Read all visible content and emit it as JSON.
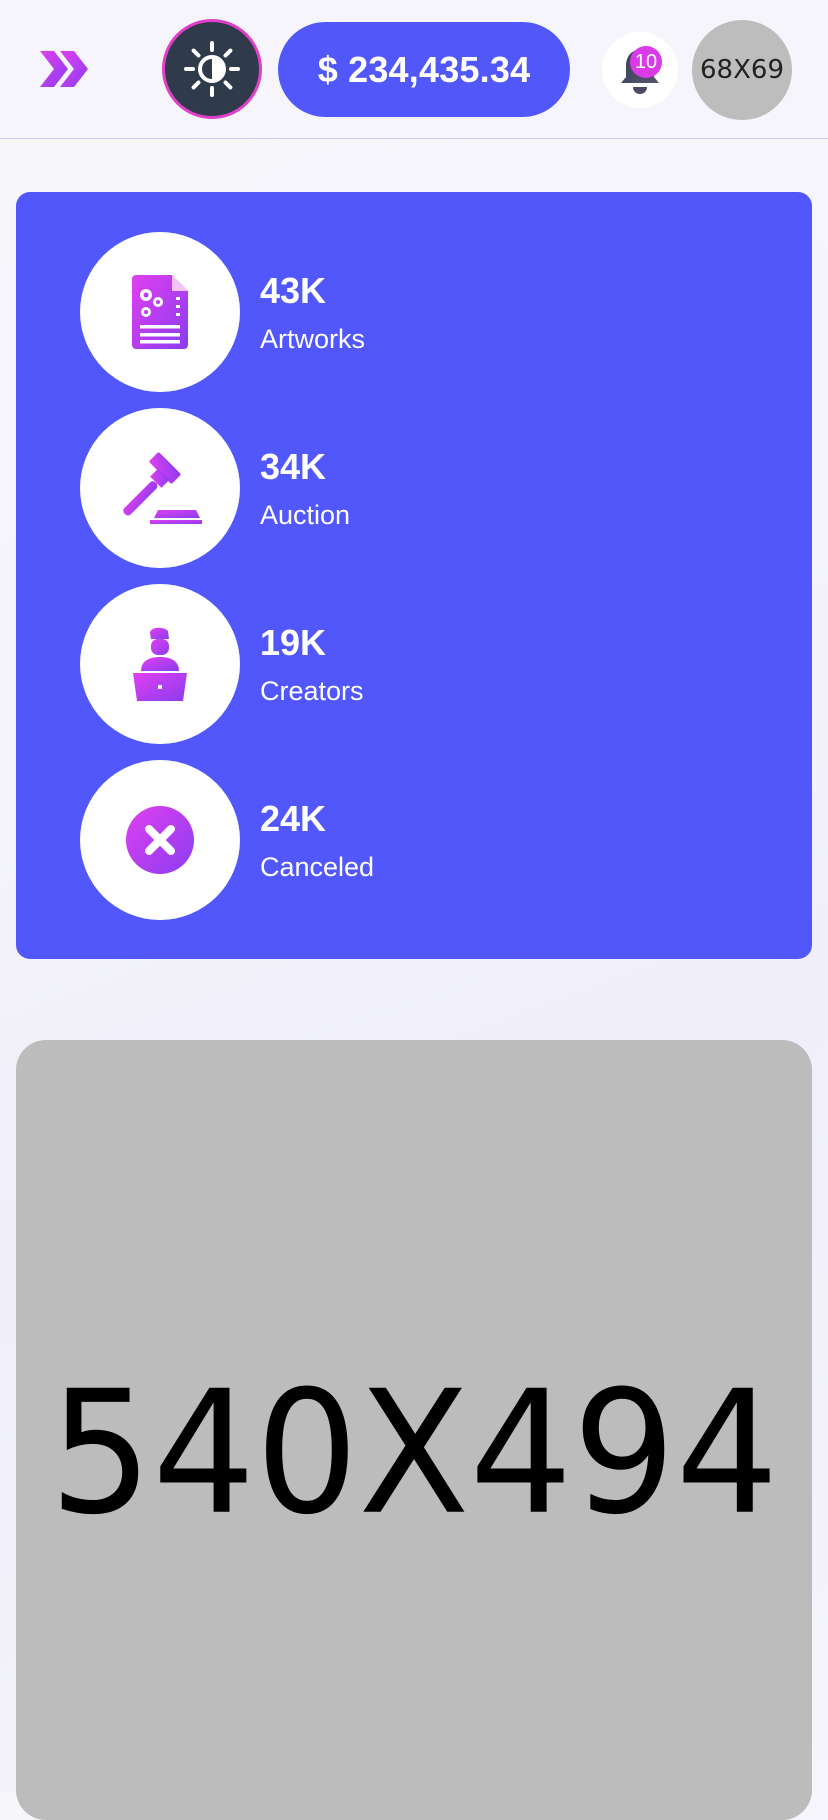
{
  "header": {
    "balance": "$ 234,435.34",
    "notification_count": "10",
    "avatar_label": "68X69"
  },
  "stats": [
    {
      "value": "43K",
      "label": "Artworks",
      "icon": "document-gear-icon"
    },
    {
      "value": "34K",
      "label": "Auction",
      "icon": "gavel-icon"
    },
    {
      "value": "19K",
      "label": "Creators",
      "icon": "creator-icon"
    },
    {
      "value": "24K",
      "label": "Canceled",
      "icon": "cancel-icon"
    }
  ],
  "image_placeholder": {
    "label": "540X494"
  },
  "colors": {
    "accent": "#5157fa",
    "icon_gradient_start": "#e040f0",
    "icon_gradient_end": "#8a3cf0",
    "theme_toggle_bg": "#2f3a4a",
    "placeholder_bg": "#bcbcbc"
  }
}
